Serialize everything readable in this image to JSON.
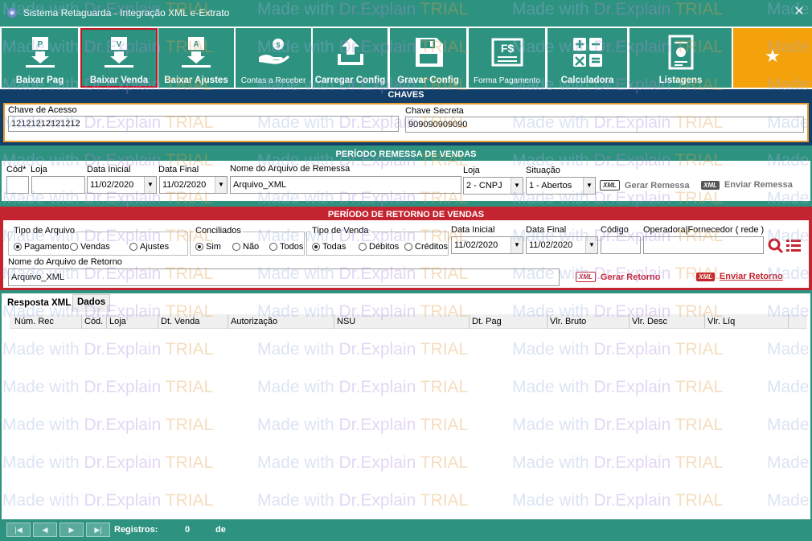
{
  "title": "Sistema Retaguarda - Integração XML e-Extrato",
  "close_symbol": "✕",
  "toolbar": [
    {
      "label": "Baixar Pag",
      "icon": "baixar-pag-icon",
      "badge": "P"
    },
    {
      "label": "Baixar Venda",
      "icon": "baixar-venda-icon",
      "badge": "V"
    },
    {
      "label": "Baixar Ajustes",
      "icon": "baixar-ajustes-icon",
      "badge": "A"
    },
    {
      "label": "Contas a Receber",
      "icon": "contas-receber-icon"
    },
    {
      "label": "Carregar Config",
      "icon": "upload-icon"
    },
    {
      "label": "Gravar Config",
      "icon": "save-icon"
    },
    {
      "label": "Forma Pagamento",
      "icon": "forma-pagamento-icon",
      "badge": "F$"
    },
    {
      "label": "Calculadora",
      "icon": "calculator-icon"
    },
    {
      "label": "Listagens",
      "icon": "report-icon"
    },
    {
      "label": "",
      "icon": "star-icon"
    }
  ],
  "star_glyph": "★",
  "chaves": {
    "header": "CHAVES",
    "acesso_label": "Chave de Acesso",
    "acesso_value": "12121212121212",
    "secreta_label": "Chave Secreta",
    "secreta_value": "909090909090"
  },
  "remessa": {
    "header": "PERÍODO REMESSA DE VENDAS",
    "cod_label": "Cód*",
    "cod_value": "",
    "loja_label": "Loja",
    "loja_value": "",
    "data_inicial_label": "Data Inicial",
    "data_inicial": "11/02/2020",
    "data_final_label": "Data Final",
    "data_final": "11/02/2020",
    "arquivo_label": "Nome do Arquivo de Remessa",
    "arquivo_value": "Arquivo_XML",
    "loja2_label": "Loja",
    "loja2_value": "2 - CNPJ",
    "situacao_label": "Situação",
    "situacao_value": "1 - Abertos",
    "xml_tag": "XML",
    "gerar": "Gerar Remessa",
    "enviar": "Enviar Remessa"
  },
  "retorno": {
    "header": "PERÍODO DE RETORNO DE VENDAS",
    "tipo_arquivo_label": "Tipo de Arquivo",
    "tipo_arquivo_options": [
      "Pagamento",
      "Vendas",
      "Ajustes"
    ],
    "conciliados_label": "Conciliados",
    "conciliados_options": [
      "Sim",
      "Não",
      "Todos"
    ],
    "tipo_venda_label": "Tipo de Venda",
    "tipo_venda_options": [
      "Todas",
      "Débitos",
      "Créditos"
    ],
    "data_inicial_label": "Data Inicial",
    "data_inicial": "11/02/2020",
    "data_final_label": "Data Final",
    "data_final": "11/02/2020",
    "codigo_label": "Código",
    "codigo_value": "",
    "operadora_label": "Operadora|Fornecedor ( rede )",
    "operadora_value": "",
    "arquivo_label": "Nome do Arquivo de Retorno",
    "arquivo_value": "Arquivo_XML",
    "xml_tag": "XML",
    "gerar": "Gerar Retorno",
    "enviar": "Enviar Retorno"
  },
  "tabs": [
    "Resposta XML",
    "Dados"
  ],
  "grid_columns": [
    "Núm. Rec",
    "Cód.",
    "Loja",
    "Dt. Venda",
    "Autorização",
    "NSU",
    "Dt. Pag",
    "Vlr. Bruto",
    "Vlr. Desc",
    "Vlr. Líq"
  ],
  "nav": [
    "|◀",
    "◀",
    "▶",
    "▶|"
  ],
  "status": {
    "label": "Registros:",
    "count": "0",
    "suffix": "de"
  },
  "watermark": {
    "a": "Made with ",
    "b": "Dr.Explain ",
    "c": "TRIAL"
  },
  "colors": {
    "teal": "#2e9280",
    "navy": "#113f69",
    "red": "#c42430",
    "orange": "#e79a2e",
    "star": "#f4a20b"
  }
}
